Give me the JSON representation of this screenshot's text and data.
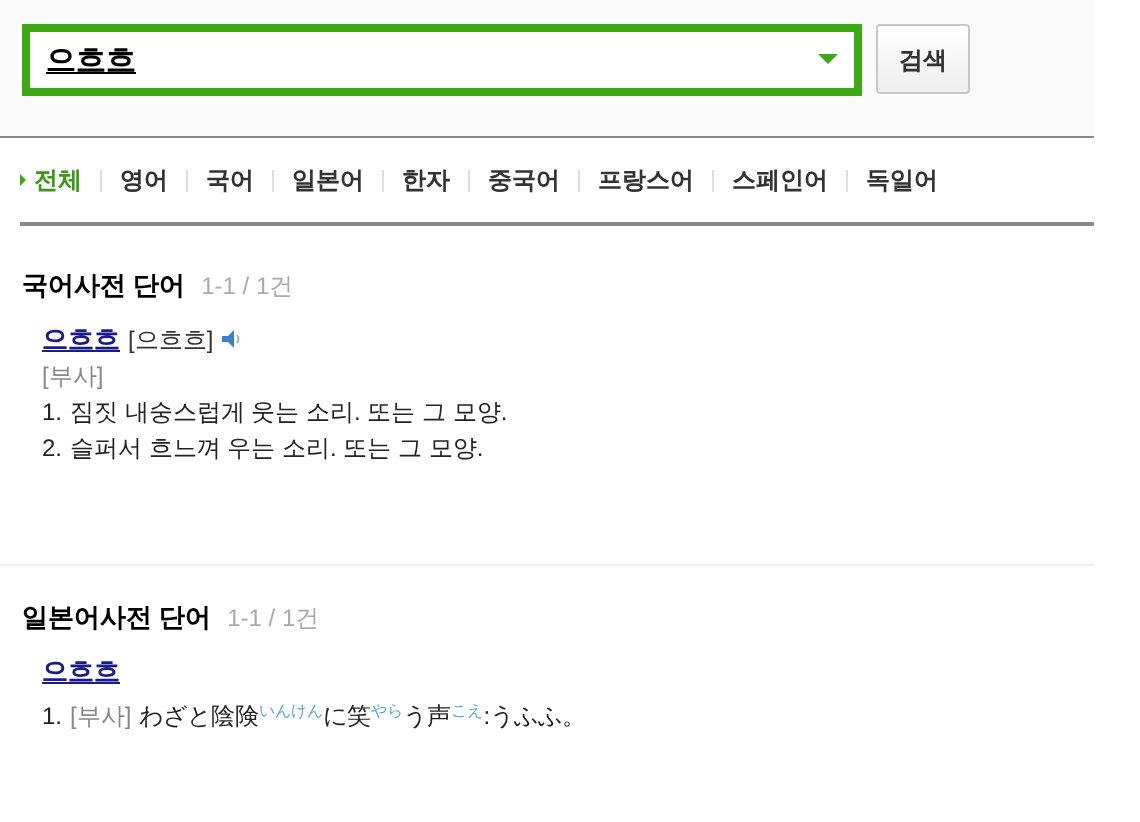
{
  "search": {
    "value": "으흐흐",
    "button": "검색"
  },
  "tabs": [
    {
      "label": "전체",
      "selected": true
    },
    {
      "label": "영어",
      "selected": false
    },
    {
      "label": "국어",
      "selected": false
    },
    {
      "label": "일본어",
      "selected": false
    },
    {
      "label": "한자",
      "selected": false
    },
    {
      "label": "중국어",
      "selected": false
    },
    {
      "label": "프랑스어",
      "selected": false
    },
    {
      "label": "스페인어",
      "selected": false
    },
    {
      "label": "독일어",
      "selected": false
    }
  ],
  "sections": [
    {
      "title": "국어사전 단어",
      "count": "1-1 / 1건",
      "entries": [
        {
          "headword": "으흐흐",
          "pronunciation": "[으흐흐]",
          "audio": true,
          "pos": "[부사]",
          "senses": [
            {
              "number": "1.",
              "text": "짐짓 내숭스럽게 웃는 소리. 또는 그 모양."
            },
            {
              "number": "2.",
              "text": "슬퍼서 흐느껴 우는 소리. 또는 그 모양."
            }
          ]
        }
      ]
    },
    {
      "title": "일본어사전 단어",
      "count": "1-1 / 1건",
      "entries": [
        {
          "headword": "으흐흐",
          "senses": [
            {
              "number": "1.",
              "pos": "[부사]",
              "text": "わざと陰険$^{いんけん}$に笑$^{やら}$う声$^{こえ}$:うふふ。"
            }
          ]
        }
      ]
    }
  ]
}
